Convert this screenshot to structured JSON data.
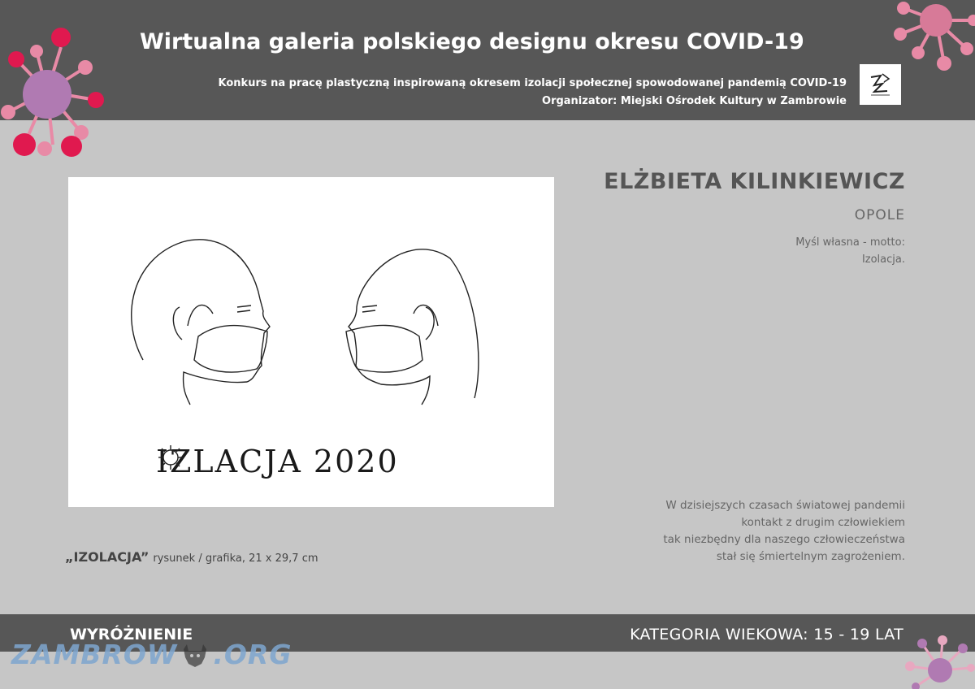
{
  "header": {
    "title": "Wirtualna galeria polskiego designu okresu COVID-19",
    "subtitle_line1": "Konkurs na pracę plastyczną inspirowaną okresem izolacji społecznej spowodowanej pandemią COVID-19",
    "subtitle_line2": "Organizator: Miejski Ośrodek Kultury w Zambrowie",
    "logo_icon": "organizer-logo"
  },
  "artwork": {
    "inscription_part1": "IZ",
    "inscription_part2": "LACJA 2020",
    "caption_title": "„IZOLACJA”",
    "caption_details": "rysunek / grafika,  21 x 29,7 cm"
  },
  "artist": {
    "name": "ELŻBIETA KILINKIEWICZ",
    "city": "OPOLE",
    "motto_line1": "Myśl własna - motto:",
    "motto_line2": "Izolacja."
  },
  "description": {
    "line1": "W dzisiejszych czasach światowej pandemii",
    "line2": "kontakt z drugim człowiekiem",
    "line3": "tak niezbędny dla naszego człowieczeństwa",
    "line4": "stał się śmiertelnym zagrożeniem."
  },
  "footer": {
    "award": "WYRÓŻNIENIE",
    "category": "KATEGORIA WIEKOWA: 15 - 19 LAT"
  },
  "watermark": {
    "part1": "ZAMBROW",
    "part2": ".ORG"
  },
  "colors": {
    "band": "#575757",
    "background": "#c6c6c6",
    "virus_body": "#b07ab2",
    "virus_spikes_red": "#e0194f",
    "virus_spikes_pink": "#e88aa6",
    "watermark": "#7ea6cf"
  }
}
